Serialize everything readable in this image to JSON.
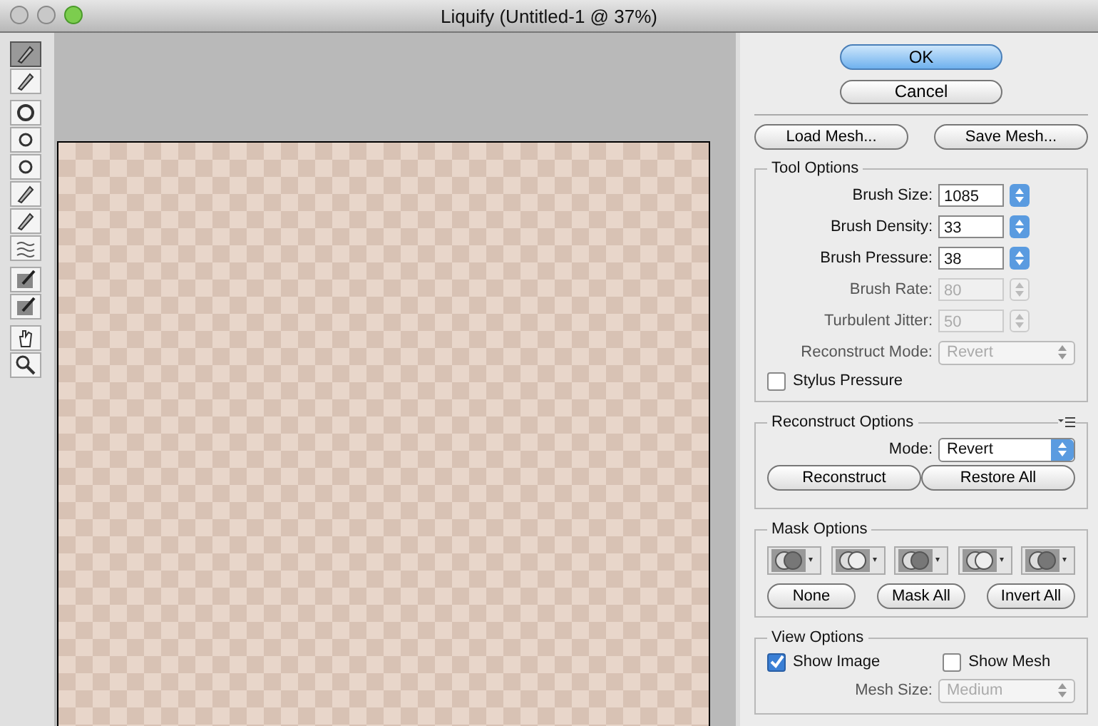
{
  "window": {
    "title": "Liquify (Untitled-1 @ 37%)"
  },
  "tools": [
    {
      "selected": true
    },
    {
      "selected": false
    },
    {
      "selected": false
    },
    {
      "selected": false
    },
    {
      "selected": false
    },
    {
      "selected": false
    },
    {
      "selected": false
    },
    {
      "selected": false
    },
    {
      "selected": false
    },
    {
      "selected": false
    },
    {
      "selected": false
    },
    {
      "selected": false
    }
  ],
  "dialog_buttons": {
    "ok": "OK",
    "cancel": "Cancel"
  },
  "mesh_buttons": [
    "Load Mesh...",
    "Save Mesh..."
  ],
  "tool_options": {
    "title": "Tool Options",
    "rows": [
      {
        "kind": "number",
        "label": "Brush Size:",
        "value": "1085",
        "disabled": false
      },
      {
        "kind": "number",
        "label": "Brush Density:",
        "value": "33",
        "disabled": false
      },
      {
        "kind": "number",
        "label": "Brush Pressure:",
        "value": "38",
        "disabled": false
      },
      {
        "kind": "number",
        "label": "Brush Rate:",
        "value": "80",
        "disabled": true
      },
      {
        "kind": "number",
        "label": "Turbulent Jitter:",
        "value": "50",
        "disabled": true
      },
      {
        "kind": "select",
        "label": "Reconstruct Mode:",
        "value": "Revert",
        "disabled": true
      }
    ],
    "stylus": {
      "label": "Stylus Pressure",
      "checked": false
    }
  },
  "reconstruct_options": {
    "title": "Reconstruct Options",
    "mode_label": "Mode:",
    "mode_value": "Revert",
    "buttons": [
      "Reconstruct",
      "Restore All"
    ]
  },
  "mask_options": {
    "title": "Mask Options",
    "buttons": [
      "None",
      "Mask All",
      "Invert All"
    ]
  },
  "view_options": {
    "title": "View Options",
    "checks": [
      {
        "label": "Show Image",
        "checked": true
      },
      {
        "label": "Show Mesh",
        "checked": false
      }
    ],
    "mesh_size_label": "Mesh Size:",
    "mesh_size_value": "Medium",
    "mesh_size_disabled": true
  }
}
